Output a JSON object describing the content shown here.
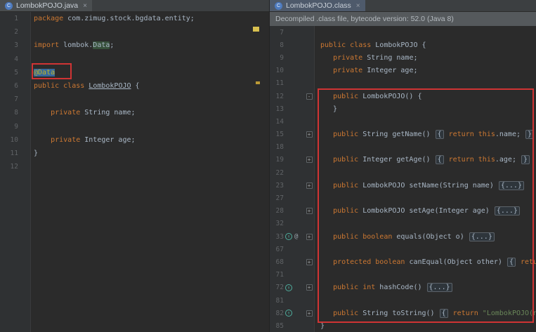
{
  "colors": {
    "editor_bg": "#2b2b2b",
    "keyword": "#cc7832",
    "default_text": "#a9b7c6",
    "annotation": "#bbb529",
    "string": "#6a8759",
    "selection": "#36689c",
    "identifier_highlight": "#37503b",
    "annotation_box": "#d03434",
    "gutter_number": "#606366",
    "active_tab": "#4e5a6b"
  },
  "left_pane": {
    "tab": {
      "label": "LombokPOJO.java",
      "close_label": "×",
      "icon_glyph": "C"
    },
    "lines": [
      {
        "n": "1",
        "tokens": [
          [
            "package",
            "k"
          ],
          [
            " com.zimug.stock.bgdata.entity;",
            "t"
          ]
        ]
      },
      {
        "n": "2",
        "tokens": []
      },
      {
        "n": "3",
        "tokens": [
          [
            "import",
            "k"
          ],
          [
            " lombok.",
            "t"
          ],
          [
            "Data",
            "t hlr"
          ],
          [
            ";",
            "t"
          ]
        ]
      },
      {
        "n": "4",
        "tokens": []
      },
      {
        "n": "5",
        "tokens": [
          [
            "@Data",
            "an sel"
          ]
        ]
      },
      {
        "n": "6",
        "tokens": [
          [
            "public",
            "k"
          ],
          [
            " ",
            "t"
          ],
          [
            "class",
            "k"
          ],
          [
            " ",
            "t"
          ],
          [
            "LombokPOJO",
            "t u"
          ],
          [
            " {",
            "t"
          ]
        ]
      },
      {
        "n": "7",
        "tokens": []
      },
      {
        "n": "8",
        "tokens": [
          [
            "    ",
            "t"
          ],
          [
            "private",
            "k"
          ],
          [
            " String name;",
            "t"
          ]
        ]
      },
      {
        "n": "9",
        "tokens": []
      },
      {
        "n": "10",
        "tokens": [
          [
            "    ",
            "t"
          ],
          [
            "private",
            "k"
          ],
          [
            " Integer age;",
            "t"
          ]
        ]
      },
      {
        "n": "11",
        "tokens": [
          [
            "}",
            "t"
          ]
        ]
      },
      {
        "n": "12",
        "tokens": []
      }
    ]
  },
  "right_pane": {
    "tab": {
      "label": "LombokPOJO.class",
      "close_label": "×",
      "icon_glyph": "C"
    },
    "banner": "Decompiled .class file, bytecode version: 52.0 (Java 8)",
    "lines": [
      {
        "n": "7",
        "tokens": []
      },
      {
        "n": "8",
        "tokens": [
          [
            "public",
            "k"
          ],
          [
            " ",
            "t"
          ],
          [
            "class",
            "k"
          ],
          [
            " LombokPOJO {",
            "t"
          ]
        ]
      },
      {
        "n": "9",
        "tokens": [
          [
            "   ",
            "t"
          ],
          [
            "private",
            "k"
          ],
          [
            " String name;",
            "t"
          ]
        ]
      },
      {
        "n": "10",
        "tokens": [
          [
            "   ",
            "t"
          ],
          [
            "private",
            "k"
          ],
          [
            " Integer age;",
            "t"
          ]
        ]
      },
      {
        "n": "11",
        "tokens": []
      },
      {
        "n": "12",
        "fold": "-",
        "tokens": [
          [
            "   ",
            "t"
          ],
          [
            "public",
            "k"
          ],
          [
            " LombokPOJO() {",
            "t"
          ]
        ]
      },
      {
        "n": "13",
        "tokens": [
          [
            "   }",
            "t"
          ]
        ]
      },
      {
        "n": "14",
        "tokens": []
      },
      {
        "n": "15",
        "fold": "+",
        "tokens": [
          [
            "   ",
            "t"
          ],
          [
            "public",
            "k"
          ],
          [
            " String getName() ",
            "t"
          ],
          [
            "{",
            "fb"
          ],
          [
            " ",
            "t"
          ],
          [
            "return",
            "k"
          ],
          [
            " ",
            "t"
          ],
          [
            "this",
            "k"
          ],
          [
            ".name; ",
            "t"
          ],
          [
            "}",
            "fb"
          ]
        ]
      },
      {
        "n": "18",
        "tokens": []
      },
      {
        "n": "19",
        "fold": "+",
        "tokens": [
          [
            "   ",
            "t"
          ],
          [
            "public",
            "k"
          ],
          [
            " Integer getAge() ",
            "t"
          ],
          [
            "{",
            "fb"
          ],
          [
            " ",
            "t"
          ],
          [
            "return",
            "k"
          ],
          [
            " ",
            "t"
          ],
          [
            "this",
            "k"
          ],
          [
            ".age; ",
            "t"
          ],
          [
            "}",
            "fb"
          ]
        ]
      },
      {
        "n": "22",
        "tokens": []
      },
      {
        "n": "23",
        "fold": "+",
        "tokens": [
          [
            "   ",
            "t"
          ],
          [
            "public",
            "k"
          ],
          [
            " LombokPOJO setName(String name) ",
            "t"
          ],
          [
            "{...}",
            "fb"
          ]
        ]
      },
      {
        "n": "27",
        "tokens": []
      },
      {
        "n": "28",
        "fold": "+",
        "tokens": [
          [
            "   ",
            "t"
          ],
          [
            "public",
            "k"
          ],
          [
            " LombokPOJO setAge(Integer age) ",
            "t"
          ],
          [
            "{...}",
            "fb"
          ]
        ]
      },
      {
        "n": "32",
        "tokens": []
      },
      {
        "n": "33",
        "icons": [
          "override",
          "at"
        ],
        "fold": "+",
        "tokens": [
          [
            "   ",
            "t"
          ],
          [
            "public",
            "k"
          ],
          [
            " ",
            "t"
          ],
          [
            "boolean",
            "k"
          ],
          [
            " equals(Object o) ",
            "t"
          ],
          [
            "{...}",
            "fb"
          ]
        ]
      },
      {
        "n": "67",
        "tokens": []
      },
      {
        "n": "68",
        "fold": "+",
        "tokens": [
          [
            "   ",
            "t"
          ],
          [
            "protected",
            "k"
          ],
          [
            " ",
            "t"
          ],
          [
            "boolean",
            "k"
          ],
          [
            " canEqual(Object other) ",
            "t"
          ],
          [
            "{",
            "fb"
          ],
          [
            " ",
            "t"
          ],
          [
            "return",
            "k"
          ]
        ]
      },
      {
        "n": "71",
        "tokens": []
      },
      {
        "n": "72",
        "icons": [
          "override"
        ],
        "fold": "+",
        "tokens": [
          [
            "   ",
            "t"
          ],
          [
            "public",
            "k"
          ],
          [
            " ",
            "t"
          ],
          [
            "int",
            "k"
          ],
          [
            " hashCode() ",
            "t"
          ],
          [
            "{...}",
            "fb"
          ]
        ]
      },
      {
        "n": "81",
        "tokens": []
      },
      {
        "n": "82",
        "icons": [
          "override"
        ],
        "fold": "+",
        "tokens": [
          [
            "   ",
            "t"
          ],
          [
            "public",
            "k"
          ],
          [
            " String toString() ",
            "t"
          ],
          [
            "{",
            "fb"
          ],
          [
            " ",
            "t"
          ],
          [
            "return",
            "k"
          ],
          [
            " ",
            "t"
          ],
          [
            "\"LombokPOJO(na",
            "s"
          ]
        ]
      },
      {
        "n": "85",
        "tokens": [
          [
            "}",
            "t"
          ]
        ]
      }
    ]
  }
}
